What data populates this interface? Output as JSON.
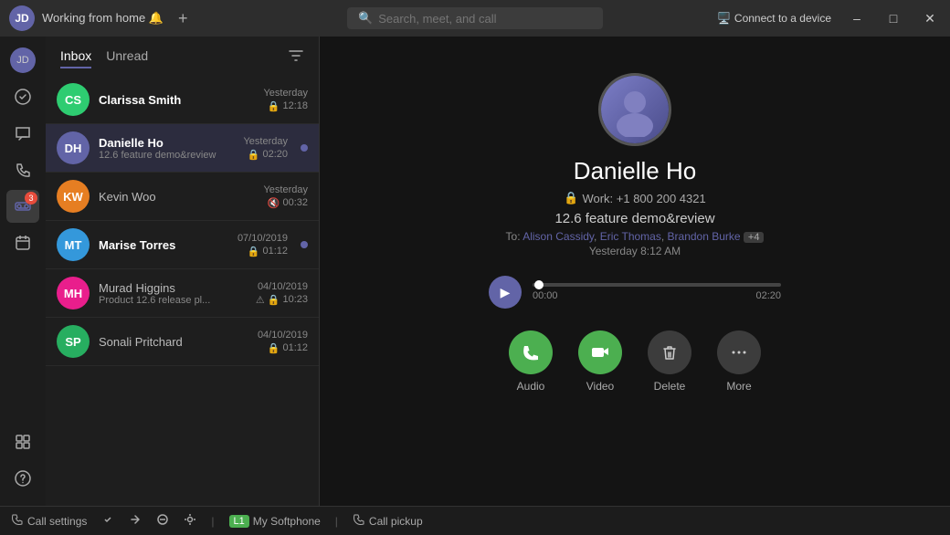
{
  "titleBar": {
    "userStatus": "Working from home 🔔",
    "searchPlaceholder": "Search, meet, and call",
    "connectLabel": "Connect to a device",
    "minimizeIcon": "–",
    "maximizeIcon": "□",
    "closeIcon": "✕"
  },
  "sidebar": {
    "icons": [
      {
        "name": "user-avatar",
        "symbol": "👤",
        "badge": null,
        "type": "avatar"
      },
      {
        "name": "activity",
        "symbol": "🔔",
        "badge": null
      },
      {
        "name": "chat",
        "symbol": "💬",
        "badge": null
      },
      {
        "name": "calls",
        "symbol": "📞",
        "badge": null
      },
      {
        "name": "voicemail",
        "symbol": "📨",
        "badge": "3",
        "active": true
      },
      {
        "name": "calendar",
        "symbol": "📅",
        "badge": null
      },
      {
        "name": "apps",
        "symbol": "⊞",
        "badge": null
      },
      {
        "name": "help",
        "symbol": "?",
        "badge": null,
        "isBottom": true
      }
    ]
  },
  "inbox": {
    "title": "Inbox",
    "tabInbox": "Inbox",
    "tabUnread": "Unread",
    "conversations": [
      {
        "id": "clarissa",
        "name": "Clarissa Smith",
        "bold": true,
        "sub": "",
        "date": "Yesterday",
        "duration": "12:18",
        "hasLock": true,
        "unread": false,
        "avatarInitials": "CS",
        "avatarColor": "av-teal"
      },
      {
        "id": "danielle",
        "name": "Danielle Ho",
        "bold": true,
        "sub": "12.6 feature demo&review",
        "date": "Yesterday",
        "duration": "02:20",
        "hasLock": true,
        "unread": true,
        "avatarInitials": "DH",
        "avatarColor": "av-purple",
        "active": true
      },
      {
        "id": "kevin",
        "name": "Kevin Woo",
        "bold": false,
        "sub": "",
        "date": "Yesterday",
        "duration": "00:32",
        "hasLock": false,
        "hasMute": true,
        "unread": false,
        "avatarInitials": "KW",
        "avatarColor": "av-orange"
      },
      {
        "id": "marise",
        "name": "Marise Torres",
        "bold": true,
        "sub": "",
        "date": "07/10/2019",
        "duration": "01:12",
        "hasLock": true,
        "unread": true,
        "avatarInitials": "MT",
        "avatarColor": "av-blue"
      },
      {
        "id": "murad",
        "name": "Murad Higgins",
        "bold": false,
        "sub": "Product 12.6 release pl...",
        "date": "04/10/2019",
        "duration": "10:23",
        "hasLock": true,
        "hasMute": true,
        "hasExclaim": true,
        "unread": false,
        "avatarInitials": "MH",
        "avatarColor": "av-pink"
      },
      {
        "id": "sonali",
        "name": "Sonali Pritchard",
        "bold": false,
        "sub": "",
        "date": "04/10/2019",
        "duration": "01:12",
        "hasLock": true,
        "unread": false,
        "avatarInitials": "SP",
        "avatarColor": "av-green"
      }
    ]
  },
  "detail": {
    "contactName": "Danielle Ho",
    "contactPhone": "Work: +1 800 200 4321",
    "voicemailSubject": "12.6 feature demo&review",
    "recipients": "To: Alison Cassidy, Eric Thomas, Brandon Burke",
    "recipientsBadge": "+4",
    "timestamp": "Yesterday 8:12 AM",
    "audioStart": "00:00",
    "audioEnd": "02:20",
    "actions": {
      "audio": "Audio",
      "video": "Video",
      "delete": "Delete",
      "more": "More"
    }
  },
  "statusBar": {
    "callSettings": "Call settings",
    "softphoneLabel": "L1",
    "softphoneName": "My Softphone",
    "callPickup": "Call pickup"
  }
}
